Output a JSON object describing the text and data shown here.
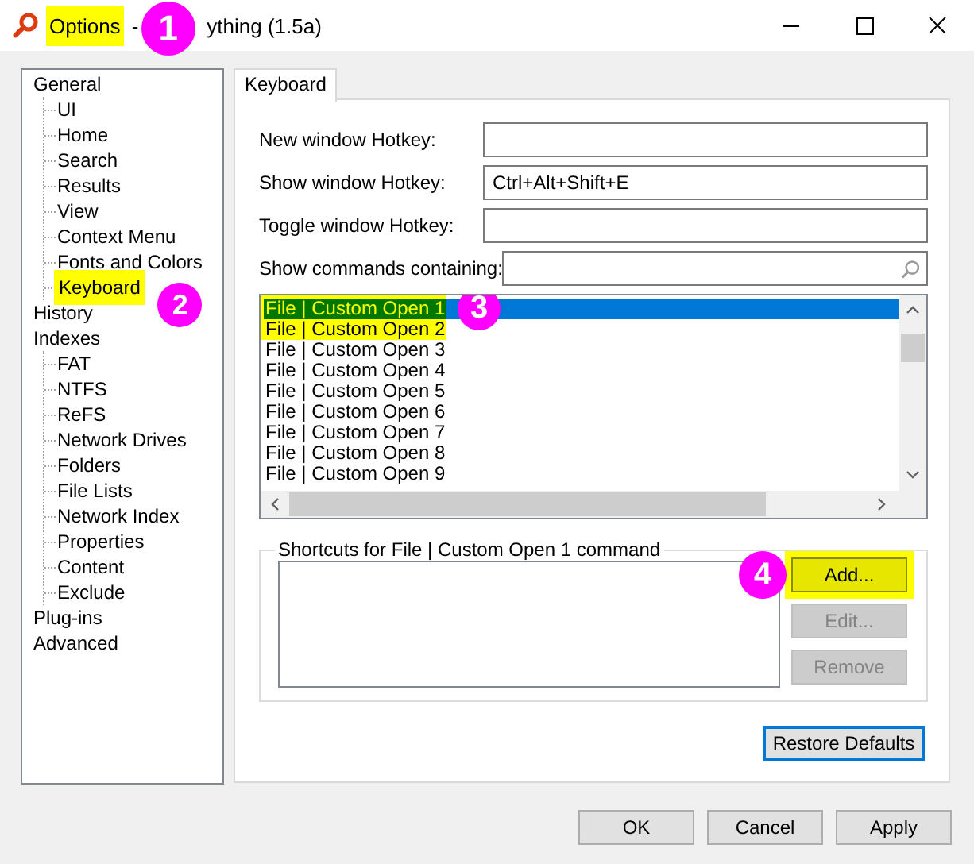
{
  "window": {
    "title_parts": [
      {
        "text": "Options",
        "highlighted": true
      },
      {
        "text": "-",
        "highlighted": false,
        "callout": "1"
      },
      {
        "text": "ything (1.5a)",
        "highlighted": false
      }
    ]
  },
  "tree": {
    "items": [
      {
        "label": "General",
        "highlighted": false,
        "children": [
          {
            "label": "UI",
            "highlighted": false
          },
          {
            "label": "Home",
            "highlighted": false
          },
          {
            "label": "Search",
            "highlighted": false
          },
          {
            "label": "Results",
            "highlighted": false
          },
          {
            "label": "View",
            "highlighted": false
          },
          {
            "label": "Context Menu",
            "highlighted": false
          },
          {
            "label": "Fonts and Colors",
            "highlighted": false
          },
          {
            "label": "Keyboard",
            "highlighted": true,
            "callout": "2"
          }
        ]
      },
      {
        "label": "History",
        "highlighted": false
      },
      {
        "label": "Indexes",
        "highlighted": false,
        "children": [
          {
            "label": "FAT",
            "highlighted": false
          },
          {
            "label": "NTFS",
            "highlighted": false
          },
          {
            "label": "ReFS",
            "highlighted": false
          },
          {
            "label": "Network Drives",
            "highlighted": false
          },
          {
            "label": "Folders",
            "highlighted": false
          },
          {
            "label": "File Lists",
            "highlighted": false
          },
          {
            "label": "Network Index",
            "highlighted": false
          },
          {
            "label": "Properties",
            "highlighted": false
          },
          {
            "label": "Content",
            "highlighted": false
          },
          {
            "label": "Exclude",
            "highlighted": false
          }
        ]
      },
      {
        "label": "Plug-ins",
        "highlighted": false
      },
      {
        "label": "Advanced",
        "highlighted": false
      }
    ]
  },
  "tabs": [
    {
      "label": "Keyboard",
      "selected": true
    }
  ],
  "fields": [
    {
      "kind": "hotkey",
      "label": "New window Hotkey:"
    },
    {
      "kind": "hotkey",
      "label": "Show window Hotkey:",
      "value": "Ctrl+Alt+Shift+E"
    },
    {
      "kind": "hotkey",
      "label": "Toggle window Hotkey:"
    },
    {
      "kind": "search",
      "label": "Show commands containing:"
    }
  ],
  "commands": {
    "callout": "3",
    "rows": [
      {
        "text": "File | Custom Open 1",
        "selected": true,
        "highlighted": true
      },
      {
        "text": "File | Custom Open 2",
        "selected": false,
        "highlighted": true
      },
      {
        "text": "File | Custom Open 3",
        "selected": false,
        "highlighted": false
      },
      {
        "text": "File | Custom Open 4",
        "selected": false,
        "highlighted": false
      },
      {
        "text": "File | Custom Open 5",
        "selected": false,
        "highlighted": false
      },
      {
        "text": "File | Custom Open 6",
        "selected": false,
        "highlighted": false
      },
      {
        "text": "File | Custom Open 7",
        "selected": false,
        "highlighted": false
      },
      {
        "text": "File | Custom Open 8",
        "selected": false,
        "highlighted": false
      },
      {
        "text": "File | Custom Open 9",
        "selected": false,
        "highlighted": false
      }
    ]
  },
  "shortcuts": {
    "legend": "Shortcuts for File | Custom Open 1 command",
    "buttons": [
      {
        "label": "Add...",
        "disabled": false,
        "highlighted": true,
        "callout": "4"
      },
      {
        "label": "Edit...",
        "disabled": true,
        "highlighted": false
      },
      {
        "label": "Remove",
        "disabled": true,
        "highlighted": false
      }
    ]
  },
  "restore_button": {
    "label": "Restore Defaults",
    "focused": true
  },
  "footer_buttons": [
    {
      "label": "OK"
    },
    {
      "label": "Cancel"
    },
    {
      "label": "Apply"
    }
  ]
}
